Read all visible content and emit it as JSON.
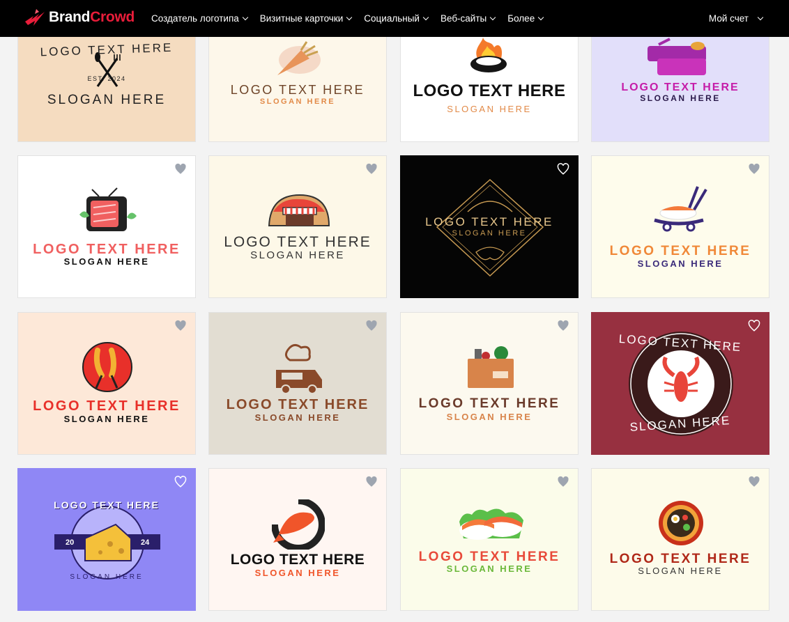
{
  "brand": {
    "part1": "Brand",
    "part2": "Crowd"
  },
  "nav": {
    "items": [
      "Создатель логотипа",
      "Визитные карточки",
      "Социальный",
      "Веб-сайты",
      "Более"
    ],
    "account": "Мой счет"
  },
  "cards": [
    {
      "main": "LOGO TEXT HERE",
      "slogan": "SLOGAN HERE",
      "badge": "EST. 2024",
      "bg": "#f5dcc0"
    },
    {
      "main": "LOGO TEXT HERE",
      "slogan": "SLOGAN HERE",
      "bg": "#fdf7ea"
    },
    {
      "main": "LOGO TEXT HERE",
      "slogan": "SLOGAN HERE",
      "bg": "#ffffff"
    },
    {
      "main": "LOGO TEXT HERE",
      "slogan": "SLOGAN HERE",
      "bg": "#e2dffa"
    },
    {
      "main": "LOGO TEXT HERE",
      "slogan": "SLOGAN HERE",
      "bg": "#ffffff"
    },
    {
      "main": "LOGO TEXT HERE",
      "slogan": "SLOGAN HERE",
      "bg": "#fdf8e8"
    },
    {
      "main": "LOGO TEXT HERE",
      "slogan": "SLOGAN HERE",
      "bg": "#050505"
    },
    {
      "main": "LOGO TEXT HERE",
      "slogan": "SLOGAN HERE",
      "bg": "#fefcec"
    },
    {
      "main": "LOGO TEXT HERE",
      "slogan": "SLOGAN HERE",
      "bg": "#fde8d8"
    },
    {
      "main": "LOGO TEXT HERE",
      "slogan": "SLOGAN HERE",
      "bg": "#e2ddd2"
    },
    {
      "main": "LOGO TEXT HERE",
      "slogan": "SLOGAN HERE",
      "bg": "#fcf9ef"
    },
    {
      "main": "LOGO TEXT HERE",
      "slogan": "SLOGAN HERE",
      "bg": "#973040"
    },
    {
      "main": "LOGO TEXT HERE",
      "slogan": "SLOGAN HERE",
      "badge_left": "20",
      "badge_right": "24",
      "bg": "#8f87f5"
    },
    {
      "main": "LOGO TEXT HERE",
      "slogan": "SLOGAN HERE",
      "bg": "#fff6f2"
    },
    {
      "main": "LOGO TEXT HERE",
      "slogan": "SLOGAN HERE",
      "bg": "#fbfcea"
    },
    {
      "main": "LOGO TEXT HERE",
      "slogan": "SLOGAN HERE",
      "bg": "#fdfbea"
    }
  ],
  "icons": [
    "logo-bolt-icon",
    "chevron-down-icon",
    "heart-icon"
  ]
}
